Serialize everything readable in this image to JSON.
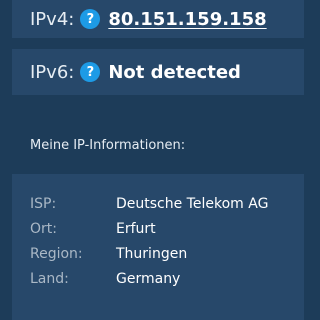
{
  "ipv4": {
    "label": "IPv4:",
    "help": "?",
    "value": "80.151.159.158"
  },
  "ipv6": {
    "label": "IPv6:",
    "help": "?",
    "value": "Not detected"
  },
  "info": {
    "title": "Meine IP-Informationen:",
    "rows": [
      {
        "key": "ISP:",
        "value": "Deutsche Telekom AG"
      },
      {
        "key": "Ort:",
        "value": "Erfurt"
      },
      {
        "key": "Region:",
        "value": "Thuringen"
      },
      {
        "key": "Land:",
        "value": "Germany"
      }
    ]
  },
  "colors": {
    "background": "#1d3c59",
    "panel": "#27486a",
    "help_badge": "#1d9be6"
  }
}
